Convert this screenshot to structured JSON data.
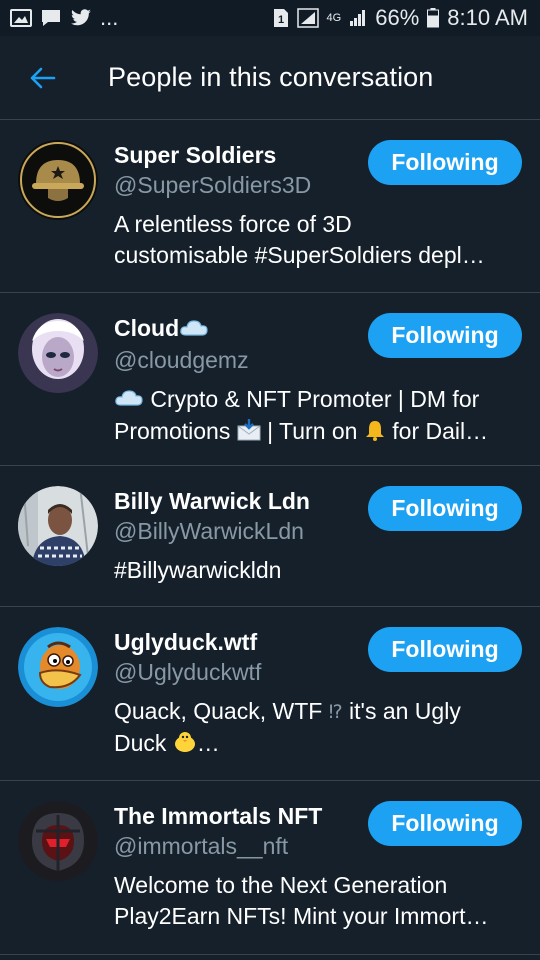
{
  "status_bar": {
    "more": "...",
    "network": "4G",
    "battery": "66%",
    "time": "8:10 AM"
  },
  "header": {
    "title": "People in this conversation",
    "back_icon": "arrow-left-icon"
  },
  "colors": {
    "background": "#15202b",
    "accent": "#1da1f2",
    "muted_text": "#8899a6",
    "divider": "#38444d"
  },
  "people": [
    {
      "name": "Super Soldiers",
      "handle": "@SuperSoldiers3D",
      "bio_lines": [
        "A relentless force of 3D",
        "customisable #SuperSoldiers depl…"
      ],
      "button": "Following"
    },
    {
      "name": "Cloud",
      "handle": "@cloudgemz",
      "bio_lines": [
        "Crypto & NFT Promoter | DM for",
        "Promotions",
        "| Turn on",
        "for Dail…"
      ],
      "button": "Following"
    },
    {
      "name": "Billy Warwick Ldn",
      "handle": "@BillyWarwickLdn",
      "bio_lines": [
        "#Billywarwickldn"
      ],
      "button": "Following"
    },
    {
      "name": "Uglyduck.wtf",
      "handle": "@Uglyduckwtf",
      "bio_lines": [
        "Quack, Quack, WTF",
        "it's an Ugly",
        "Duck",
        "…"
      ],
      "button": "Following"
    },
    {
      "name": "The Immortals NFT",
      "handle": "@immortals__nft",
      "bio_lines": [
        "Welcome to the Next Generation",
        "Play2Earn NFTs! Mint your Immort…"
      ],
      "button": "Following"
    }
  ]
}
